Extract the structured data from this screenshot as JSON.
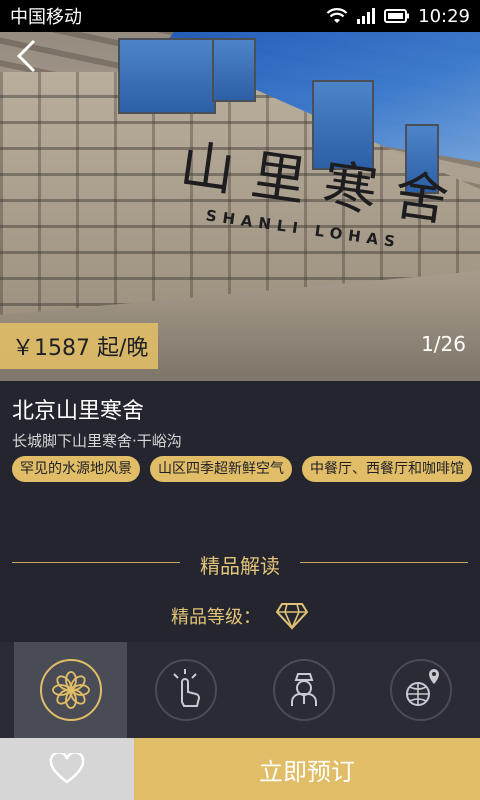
{
  "status_bar": {
    "carrier": "中国移动",
    "time": "10:29"
  },
  "hero": {
    "sign_main": "山里寒舍",
    "sign_sub": "SHANLI LOHAS",
    "price_label": "￥1587 起/晚",
    "photo_counter": "1/26"
  },
  "hotel": {
    "name": "北京山里寒舍",
    "location": "长城脚下山里寒舍·干峪沟"
  },
  "tags": [
    "罕见的水源地风景",
    "山区四季超新鲜空气",
    "中餐厅、西餐厅和咖啡馆"
  ],
  "section": {
    "title": "精品解读",
    "grade_label": "精品等级："
  },
  "features": [
    {
      "icon": "flower-icon",
      "active": true
    },
    {
      "icon": "touch-hand-icon",
      "active": false
    },
    {
      "icon": "service-staff-icon",
      "active": false
    },
    {
      "icon": "globe-location-icon",
      "active": false
    }
  ],
  "bottom_bar": {
    "book_label": "立即预订"
  },
  "colors": {
    "gold": "#e0bd66",
    "background": "#24252f"
  }
}
